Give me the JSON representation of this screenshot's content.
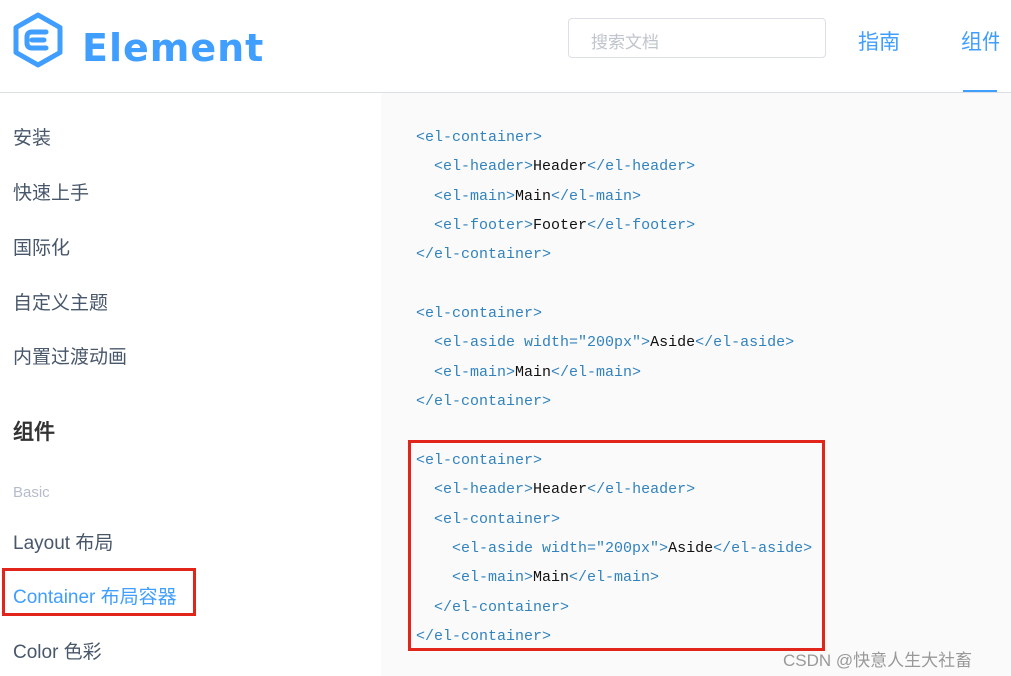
{
  "header": {
    "logo_text": "Element",
    "search_placeholder": "搜索文档",
    "nav": {
      "guide": "指南",
      "components": "组件"
    }
  },
  "sidebar": {
    "items_top": [
      "安装",
      "快速上手",
      "国际化",
      "自定义主题",
      "内置过渡动画"
    ],
    "group_title": "组件",
    "subgroup": "Basic",
    "items_basic": [
      "Layout 布局",
      "Container 布局容器",
      "Color 色彩"
    ],
    "active": "Container 布局容器"
  },
  "code": {
    "lines": [
      {
        "indent": "",
        "open": "<el-container>",
        "text": "",
        "close": ""
      },
      {
        "indent": "  ",
        "open": "<el-header>",
        "text": "Header",
        "close": "</el-header>"
      },
      {
        "indent": "  ",
        "open": "<el-main>",
        "text": "Main",
        "close": "</el-main>"
      },
      {
        "indent": "  ",
        "open": "<el-footer>",
        "text": "Footer",
        "close": "</el-footer>"
      },
      {
        "indent": "",
        "open": "</el-container>",
        "text": "",
        "close": ""
      },
      {
        "indent": "",
        "open": "",
        "text": "",
        "close": ""
      },
      {
        "indent": "",
        "open": "<el-container>",
        "text": "",
        "close": ""
      },
      {
        "indent": "  ",
        "open": "<el-aside width=\"200px\">",
        "text": "Aside",
        "close": "</el-aside>"
      },
      {
        "indent": "  ",
        "open": "<el-main>",
        "text": "Main",
        "close": "</el-main>"
      },
      {
        "indent": "",
        "open": "</el-container>",
        "text": "",
        "close": ""
      },
      {
        "indent": "",
        "open": "",
        "text": "",
        "close": ""
      },
      {
        "indent": "",
        "open": "<el-container>",
        "text": "",
        "close": ""
      },
      {
        "indent": "  ",
        "open": "<el-header>",
        "text": "Header",
        "close": "</el-header>"
      },
      {
        "indent": "  ",
        "open": "<el-container>",
        "text": "",
        "close": ""
      },
      {
        "indent": "    ",
        "open": "<el-aside width=\"200px\">",
        "text": "Aside",
        "close": "</el-aside>"
      },
      {
        "indent": "    ",
        "open": "<el-main>",
        "text": "Main",
        "close": "</el-main>"
      },
      {
        "indent": "  ",
        "open": "</el-container>",
        "text": "",
        "close": ""
      },
      {
        "indent": "",
        "open": "</el-container>",
        "text": "",
        "close": ""
      }
    ]
  },
  "watermark": "CSDN @快意人生大社畜",
  "colors": {
    "brand": "#409eff",
    "highlight_box": "#e1251b",
    "code_tag": "#3182bd",
    "code_bg": "#fafafa"
  }
}
